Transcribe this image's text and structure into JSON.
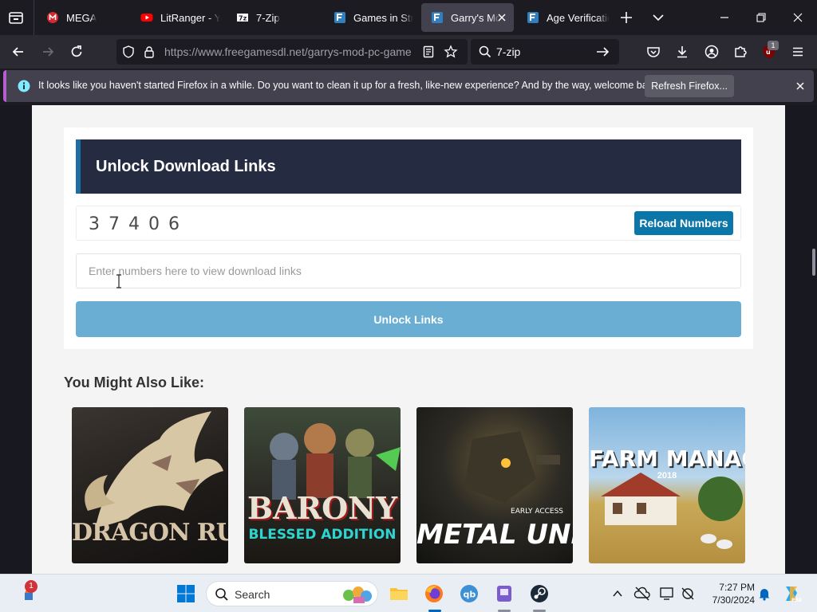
{
  "browser": {
    "tabs": [
      {
        "title": "MEGA",
        "icon": "mega-icon",
        "active": false
      },
      {
        "title": "LitRanger - Yo",
        "icon": "youtube-icon",
        "active": false
      },
      {
        "title": "7-Zip",
        "icon": "sevenzip-icon",
        "active": false
      },
      {
        "title": "Games in Strat",
        "icon": "freegamesdl-icon",
        "active": false
      },
      {
        "title": "Garry's Mod",
        "icon": "freegamesdl-icon",
        "active": true
      },
      {
        "title": "Age Verificatio",
        "icon": "freegamesdl-icon",
        "active": false
      }
    ],
    "url": "https://www.freegamesdl.net/garrys-mod-pc-game",
    "search_text": "7-zip",
    "extension_badge": "1"
  },
  "notification": {
    "message": "It looks like you haven't started Firefox in a while. Do you want to clean it up for a fresh, like-new experience? And by the way, welcome back!",
    "button_label": "Refresh Firefox..."
  },
  "unlock": {
    "heading": "Unlock Download Links",
    "digits": "37406",
    "reload_label": "Reload Numbers",
    "input_placeholder": "Enter numbers here to view download links",
    "unlock_label": "Unlock Links"
  },
  "related": {
    "heading": "You Might Also Like:",
    "games": [
      {
        "title": "DRAGON RUINS"
      },
      {
        "title": "BARONY",
        "subtitle": "BLESSED ADDITION"
      },
      {
        "title": "METAL UNIT",
        "tag": "EARLY ACCESS"
      },
      {
        "title": "FARM MANAGER",
        "year": "2018"
      }
    ]
  },
  "taskbar": {
    "search_label": "Search",
    "time": "7:27 PM",
    "date": "7/30/2024",
    "start_badge": "1"
  },
  "colors": {
    "accent_blue": "#0d76a9",
    "header_navy": "#252c42",
    "unlock_button": "#6aaed3",
    "notice_stripe": "#b65ecf"
  }
}
